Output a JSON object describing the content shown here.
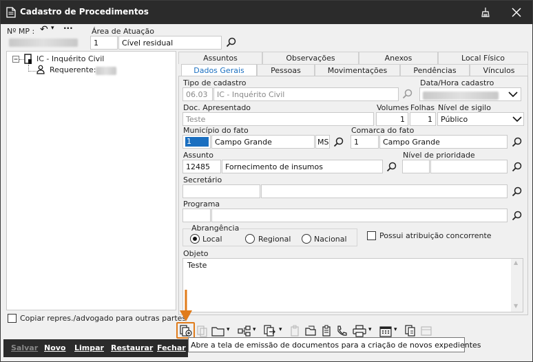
{
  "window": {
    "title": "Cadastro de Procedimentos"
  },
  "header": {
    "mp_label": "Nº MP :",
    "area_label": "Área de Atuação",
    "area_code": "1",
    "area_name": "Cível residual"
  },
  "tree": {
    "root": "IC - Inquérito Civil",
    "child_label": "Requerente:",
    "copy_checkbox_label": "Copiar repres./advogado para outras partes"
  },
  "tabs_row1": [
    "Assuntos",
    "Observações",
    "Anexos",
    "Local Físico"
  ],
  "tabs_row2": [
    "Dados Gerais",
    "Pessoas",
    "Movimentações",
    "Pendências",
    "Vínculos"
  ],
  "form": {
    "tipo_label": "Tipo de cadastro",
    "tipo_code": "06.03",
    "tipo_name": "IC - Inquérito Civil",
    "data_label": "Data/Hora cadastro",
    "doc_label": "Doc. Apresentado",
    "doc_value": "Teste",
    "volumes_label": "Volumes",
    "volumes_value": "1",
    "folhas_label": "Folhas",
    "folhas_value": "1",
    "sigilo_label": "Nível de sigilo",
    "sigilo_value": "Público",
    "municipio_label": "Município do fato",
    "municipio_code": "1",
    "municipio_name": "Campo Grande",
    "municipio_uf": "MS",
    "comarca_label": "Comarca do fato",
    "comarca_code": "1",
    "comarca_name": "Campo Grande",
    "assunto_label": "Assunto",
    "assunto_code": "12485",
    "assunto_name": "Fornecimento de insumos",
    "prioridade_label": "Nível de prioridade",
    "secretario_label": "Secretário",
    "programa_label": "Programa",
    "abrangencia_label": "Abrangência",
    "radio_local": "Local",
    "radio_regional": "Regional",
    "radio_nacional": "Nacional",
    "concorrente_label": "Possui atribuição concorrente",
    "objeto_label": "Objeto",
    "objeto_value": "Teste"
  },
  "bottom": {
    "salvar": "Salvar",
    "novo": "Novo",
    "limpar": "Limpar",
    "restaurar": "Restaurar",
    "fechar": "Fechar"
  },
  "tooltip": "Abre a tela de emissão de documentos para a criação de novos expedientes",
  "colors": {
    "accent": "#e07b1a",
    "tab_active": "#1a6fc0",
    "titlebar": "#2b2b2b"
  }
}
